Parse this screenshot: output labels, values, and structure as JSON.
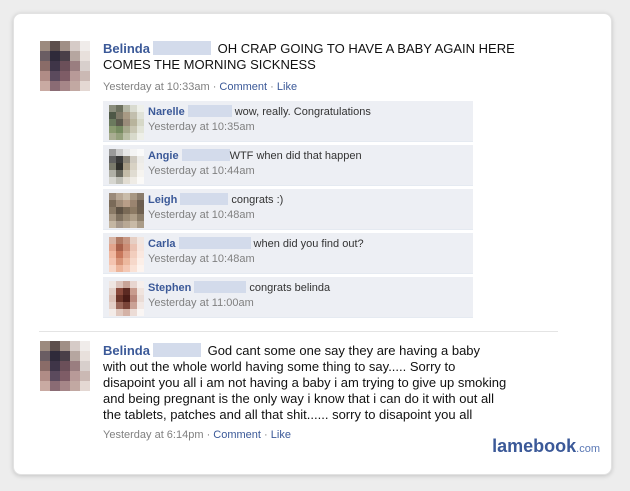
{
  "colors": {
    "link": "#3b5998",
    "comment_bg": "#edeff4",
    "redaction": "#d3dbeb"
  },
  "post1": {
    "author": "Belinda",
    "text_line1": "OH CRAP GOING TO HAVE A BABY AGAIN HERE",
    "text_line2": "COMES THE MORNING SICKNESS",
    "timestamp": "Yesterday at 10:33am",
    "sep1": "·",
    "comment_label": "Comment",
    "sep2": "·",
    "like_label": "Like"
  },
  "comments": [
    {
      "author": "Narelle",
      "text": "wow, really. Congratulations",
      "timestamp": "Yesterday at 10:35am"
    },
    {
      "author": "Angie",
      "text": "WTF when did that happen",
      "timestamp": "Yesterday at 10:44am"
    },
    {
      "author": "Leigh",
      "text": "congrats :)",
      "timestamp": "Yesterday at 10:48am"
    },
    {
      "author": "Carla",
      "text": "when did you find out?",
      "timestamp": "Yesterday at 10:48am"
    },
    {
      "author": "Stephen",
      "text": "congrats belinda",
      "timestamp": "Yesterday at 11:00am"
    }
  ],
  "post2": {
    "author": "Belinda",
    "line1": "God cant some one say they are having a baby",
    "line2": "with out the whole world having some thing to say..... Sorry to",
    "line3": "disapoint you all i am not having a baby i am trying to give up smoking",
    "line4": "and being pregnant is the only way i know that i can do it with out all",
    "line5": "the tablets, patches and all that shit...... sorry to disapoint you all",
    "timestamp": "Yesterday at 6:14pm",
    "sep1": "·",
    "comment_label": "Comment",
    "sep2": "·",
    "like_label": "Like"
  },
  "watermark": {
    "brand": "lamebook",
    "suffix": ".com"
  }
}
